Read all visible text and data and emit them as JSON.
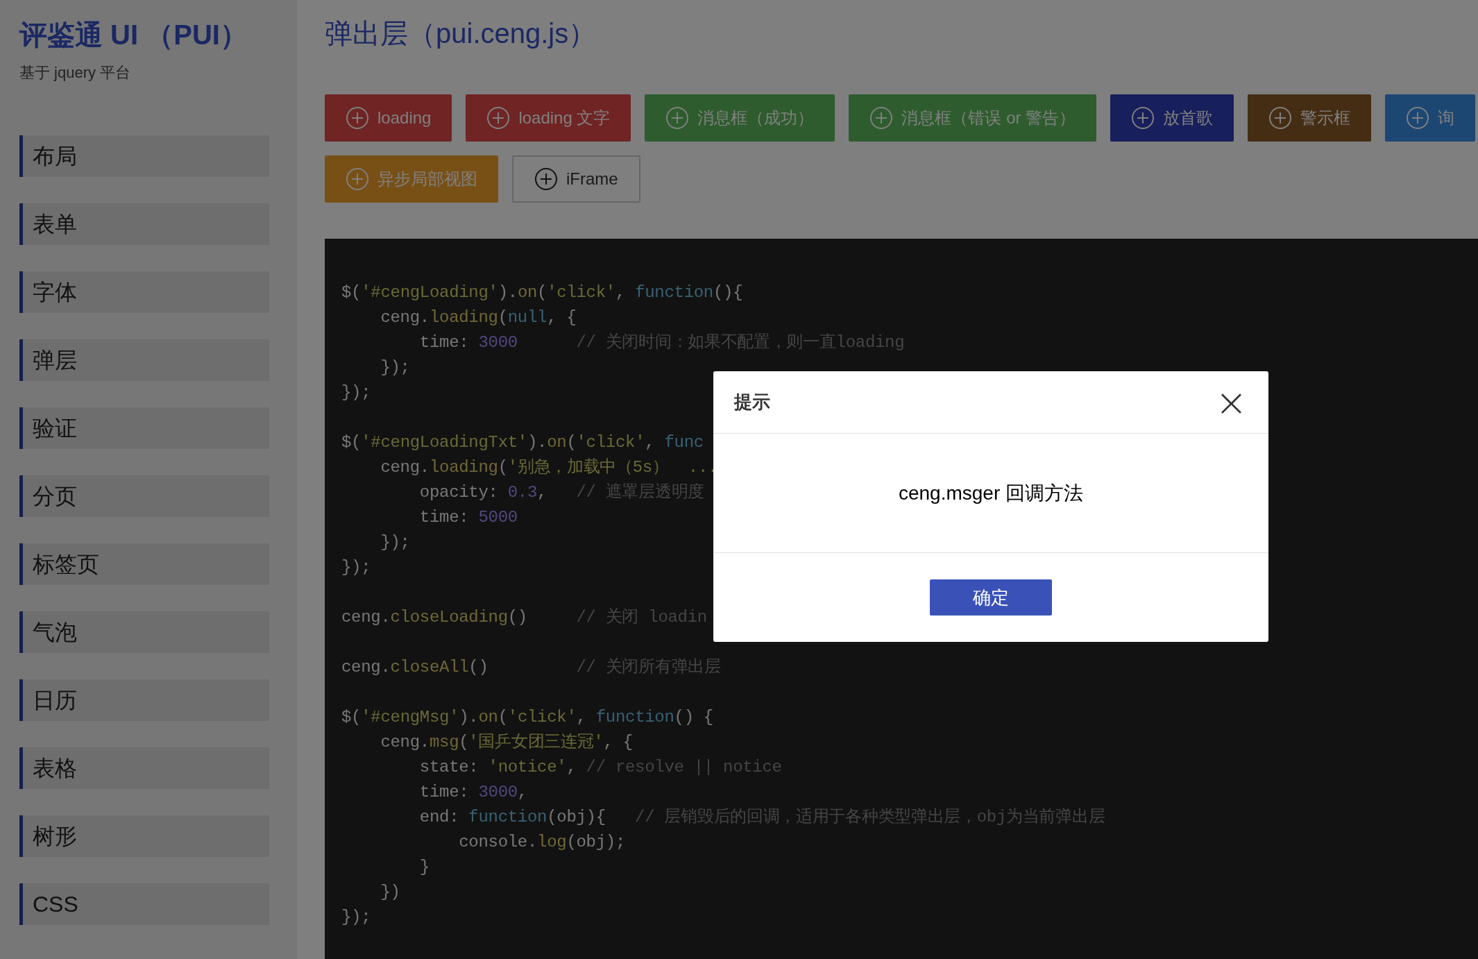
{
  "sidebar": {
    "title": "评鉴通 UI （PUI）",
    "subtitle": "基于 jquery 平台",
    "items": [
      {
        "label": "布局"
      },
      {
        "label": "表单"
      },
      {
        "label": "字体"
      },
      {
        "label": "弹层"
      },
      {
        "label": "验证"
      },
      {
        "label": "分页"
      },
      {
        "label": "标签页"
      },
      {
        "label": "气泡"
      },
      {
        "label": "日历"
      },
      {
        "label": "表格"
      },
      {
        "label": "树形"
      },
      {
        "label": "CSS"
      }
    ]
  },
  "page_title": "弹出层（pui.ceng.js）",
  "buttons": [
    {
      "label": "loading",
      "kind": "danger"
    },
    {
      "label": "loading 文字",
      "kind": "danger"
    },
    {
      "label": "消息框（成功）",
      "kind": "success"
    },
    {
      "label": "消息框（错误 or 警告）",
      "kind": "success"
    },
    {
      "label": "放首歌",
      "kind": "primary"
    },
    {
      "label": "警示框",
      "kind": "brown"
    },
    {
      "label": "询",
      "kind": "info"
    },
    {
      "label": "异步局部视图",
      "kind": "warning"
    },
    {
      "label": "iFrame",
      "kind": "default"
    }
  ],
  "code_snippets": [
    {
      "lines": [
        {
          "tokens": [
            {
              "kind": "p",
              "text": "$("
            },
            {
              "kind": "s",
              "text": "'#cengLoading'"
            },
            {
              "kind": "p",
              "text": ")."
            },
            {
              "kind": "f",
              "text": "on"
            },
            {
              "kind": "p",
              "text": "("
            },
            {
              "kind": "s",
              "text": "'click'"
            },
            {
              "kind": "p",
              "text": ", "
            },
            {
              "kind": "k",
              "text": "function"
            },
            {
              "kind": "p",
              "text": "(){"
            }
          ]
        },
        {
          "tokens": [
            {
              "kind": "p",
              "text": "    ceng."
            },
            {
              "kind": "f",
              "text": "loading"
            },
            {
              "kind": "p",
              "text": "("
            },
            {
              "kind": "k",
              "text": "null"
            },
            {
              "kind": "p",
              "text": ", {"
            }
          ]
        },
        {
          "tokens": [
            {
              "kind": "p",
              "text": "        time: "
            },
            {
              "kind": "n",
              "text": "3000"
            },
            {
              "kind": "c",
              "text": "      // 关闭时间：如果不配置，则一直loading"
            }
          ]
        },
        {
          "tokens": [
            {
              "kind": "p",
              "text": "    });"
            }
          ]
        },
        {
          "tokens": [
            {
              "kind": "p",
              "text": "});"
            }
          ]
        }
      ]
    },
    {
      "lines": [
        {
          "tokens": [
            {
              "kind": "p",
              "text": "$("
            },
            {
              "kind": "s",
              "text": "'#cengLoadingTxt'"
            },
            {
              "kind": "p",
              "text": ")."
            },
            {
              "kind": "f",
              "text": "on"
            },
            {
              "kind": "p",
              "text": "("
            },
            {
              "kind": "s",
              "text": "'click'"
            },
            {
              "kind": "p",
              "text": ", "
            },
            {
              "kind": "k",
              "text": "func"
            }
          ]
        },
        {
          "tokens": [
            {
              "kind": "p",
              "text": "    ceng."
            },
            {
              "kind": "f",
              "text": "loading"
            },
            {
              "kind": "p",
              "text": "("
            },
            {
              "kind": "s",
              "text": "'别急，加载中（5s）  ..."
            }
          ]
        },
        {
          "tokens": [
            {
              "kind": "p",
              "text": "        opacity: "
            },
            {
              "kind": "n",
              "text": "0.3"
            },
            {
              "kind": "p",
              "text": ",   "
            },
            {
              "kind": "c",
              "text": "// 遮罩层透明度"
            }
          ]
        },
        {
          "tokens": [
            {
              "kind": "p",
              "text": "        time: "
            },
            {
              "kind": "n",
              "text": "5000"
            }
          ]
        },
        {
          "tokens": [
            {
              "kind": "p",
              "text": "    });"
            }
          ]
        },
        {
          "tokens": [
            {
              "kind": "p",
              "text": "});"
            }
          ]
        }
      ]
    },
    {
      "lines": [
        {
          "tokens": [
            {
              "kind": "p",
              "text": "ceng."
            },
            {
              "kind": "f",
              "text": "closeLoading"
            },
            {
              "kind": "p",
              "text": "()"
            },
            {
              "kind": "c",
              "text": "     // 关闭 loadin"
            }
          ]
        }
      ]
    },
    {
      "lines": [
        {
          "tokens": [
            {
              "kind": "p",
              "text": "ceng."
            },
            {
              "kind": "f",
              "text": "closeAll"
            },
            {
              "kind": "p",
              "text": "()"
            },
            {
              "kind": "c",
              "text": "         // 关闭所有弹出层"
            }
          ]
        }
      ]
    },
    {
      "lines": [
        {
          "tokens": [
            {
              "kind": "p",
              "text": "$("
            },
            {
              "kind": "s",
              "text": "'#cengMsg'"
            },
            {
              "kind": "p",
              "text": ")."
            },
            {
              "kind": "f",
              "text": "on"
            },
            {
              "kind": "p",
              "text": "("
            },
            {
              "kind": "s",
              "text": "'click'"
            },
            {
              "kind": "p",
              "text": ", "
            },
            {
              "kind": "k",
              "text": "function"
            },
            {
              "kind": "p",
              "text": "() {"
            }
          ]
        },
        {
          "tokens": [
            {
              "kind": "p",
              "text": "    ceng."
            },
            {
              "kind": "f",
              "text": "msg"
            },
            {
              "kind": "p",
              "text": "("
            },
            {
              "kind": "s",
              "text": "'国乒女团三连冠'"
            },
            {
              "kind": "p",
              "text": ", {"
            }
          ]
        },
        {
          "tokens": [
            {
              "kind": "p",
              "text": "        state: "
            },
            {
              "kind": "s",
              "text": "'notice'"
            },
            {
              "kind": "p",
              "text": ", "
            },
            {
              "kind": "c",
              "text": "// resolve || notice"
            }
          ]
        },
        {
          "tokens": [
            {
              "kind": "p",
              "text": "        time: "
            },
            {
              "kind": "n",
              "text": "3000"
            },
            {
              "kind": "p",
              "text": ","
            }
          ]
        },
        {
          "tokens": [
            {
              "kind": "p",
              "text": "        end: "
            },
            {
              "kind": "k",
              "text": "function"
            },
            {
              "kind": "p",
              "text": "(obj){   "
            },
            {
              "kind": "c",
              "text": "// 层销毁后的回调，适用于各种类型弹出层，obj为当前弹出层"
            }
          ]
        },
        {
          "tokens": [
            {
              "kind": "p",
              "text": "            console."
            },
            {
              "kind": "f",
              "text": "log"
            },
            {
              "kind": "p",
              "text": "(obj);"
            }
          ]
        },
        {
          "tokens": [
            {
              "kind": "p",
              "text": "        }"
            }
          ]
        },
        {
          "tokens": [
            {
              "kind": "p",
              "text": "    })"
            }
          ]
        },
        {
          "tokens": [
            {
              "kind": "p",
              "text": "});"
            }
          ]
        }
      ]
    }
  ],
  "dialog": {
    "title": "提示",
    "close": "×",
    "message": "ceng.msger 回调方法",
    "ok": "确定"
  }
}
